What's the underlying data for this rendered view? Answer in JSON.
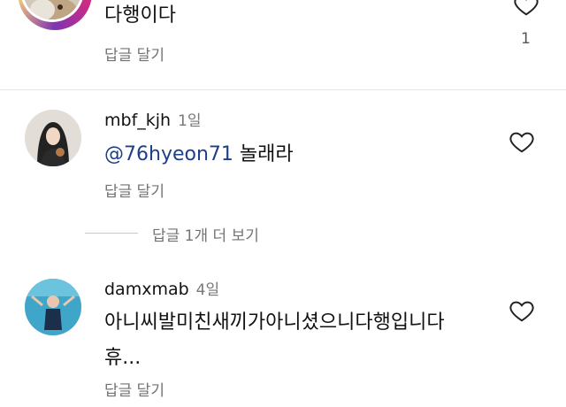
{
  "comments": [
    {
      "text": "다행이다",
      "reply_label": "답글 달기",
      "like_count": "1",
      "like_icon": "heart-outline-icon",
      "ring_colors": [
        "#f58529",
        "#dd2a7b",
        "#8134af",
        "#feda77"
      ]
    },
    {
      "username": "mbf_kjh",
      "time": "1일",
      "mention": "@76hyeon71",
      "text": "놀래라",
      "reply_label": "답글 달기",
      "like_icon": "heart-outline-icon",
      "mention_color": "#1d3f8a"
    },
    {
      "username": "damxmab",
      "time": "4일",
      "text_line1": "아니씨발미친새끼가아니셨으니다행입니다",
      "text_line2": "휴...",
      "reply_label": "답글 달기",
      "like_icon": "heart-outline-icon"
    }
  ],
  "view_replies": "답글 1개 더 보기"
}
